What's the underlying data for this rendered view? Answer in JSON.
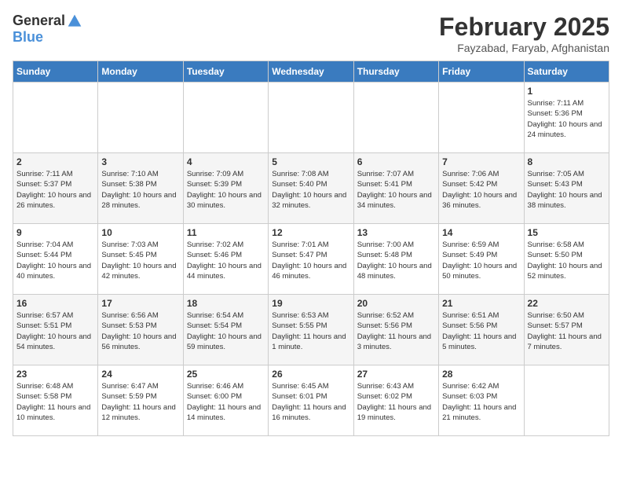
{
  "logo": {
    "general": "General",
    "blue": "Blue"
  },
  "title": "February 2025",
  "location": "Fayzabad, Faryab, Afghanistan",
  "days_of_week": [
    "Sunday",
    "Monday",
    "Tuesday",
    "Wednesday",
    "Thursday",
    "Friday",
    "Saturday"
  ],
  "weeks": [
    [
      {
        "day": "",
        "info": ""
      },
      {
        "day": "",
        "info": ""
      },
      {
        "day": "",
        "info": ""
      },
      {
        "day": "",
        "info": ""
      },
      {
        "day": "",
        "info": ""
      },
      {
        "day": "",
        "info": ""
      },
      {
        "day": "1",
        "info": "Sunrise: 7:11 AM\nSunset: 5:36 PM\nDaylight: 10 hours and 24 minutes."
      }
    ],
    [
      {
        "day": "2",
        "info": "Sunrise: 7:11 AM\nSunset: 5:37 PM\nDaylight: 10 hours and 26 minutes."
      },
      {
        "day": "3",
        "info": "Sunrise: 7:10 AM\nSunset: 5:38 PM\nDaylight: 10 hours and 28 minutes."
      },
      {
        "day": "4",
        "info": "Sunrise: 7:09 AM\nSunset: 5:39 PM\nDaylight: 10 hours and 30 minutes."
      },
      {
        "day": "5",
        "info": "Sunrise: 7:08 AM\nSunset: 5:40 PM\nDaylight: 10 hours and 32 minutes."
      },
      {
        "day": "6",
        "info": "Sunrise: 7:07 AM\nSunset: 5:41 PM\nDaylight: 10 hours and 34 minutes."
      },
      {
        "day": "7",
        "info": "Sunrise: 7:06 AM\nSunset: 5:42 PM\nDaylight: 10 hours and 36 minutes."
      },
      {
        "day": "8",
        "info": "Sunrise: 7:05 AM\nSunset: 5:43 PM\nDaylight: 10 hours and 38 minutes."
      }
    ],
    [
      {
        "day": "9",
        "info": "Sunrise: 7:04 AM\nSunset: 5:44 PM\nDaylight: 10 hours and 40 minutes."
      },
      {
        "day": "10",
        "info": "Sunrise: 7:03 AM\nSunset: 5:45 PM\nDaylight: 10 hours and 42 minutes."
      },
      {
        "day": "11",
        "info": "Sunrise: 7:02 AM\nSunset: 5:46 PM\nDaylight: 10 hours and 44 minutes."
      },
      {
        "day": "12",
        "info": "Sunrise: 7:01 AM\nSunset: 5:47 PM\nDaylight: 10 hours and 46 minutes."
      },
      {
        "day": "13",
        "info": "Sunrise: 7:00 AM\nSunset: 5:48 PM\nDaylight: 10 hours and 48 minutes."
      },
      {
        "day": "14",
        "info": "Sunrise: 6:59 AM\nSunset: 5:49 PM\nDaylight: 10 hours and 50 minutes."
      },
      {
        "day": "15",
        "info": "Sunrise: 6:58 AM\nSunset: 5:50 PM\nDaylight: 10 hours and 52 minutes."
      }
    ],
    [
      {
        "day": "16",
        "info": "Sunrise: 6:57 AM\nSunset: 5:51 PM\nDaylight: 10 hours and 54 minutes."
      },
      {
        "day": "17",
        "info": "Sunrise: 6:56 AM\nSunset: 5:53 PM\nDaylight: 10 hours and 56 minutes."
      },
      {
        "day": "18",
        "info": "Sunrise: 6:54 AM\nSunset: 5:54 PM\nDaylight: 10 hours and 59 minutes."
      },
      {
        "day": "19",
        "info": "Sunrise: 6:53 AM\nSunset: 5:55 PM\nDaylight: 11 hours and 1 minute."
      },
      {
        "day": "20",
        "info": "Sunrise: 6:52 AM\nSunset: 5:56 PM\nDaylight: 11 hours and 3 minutes."
      },
      {
        "day": "21",
        "info": "Sunrise: 6:51 AM\nSunset: 5:56 PM\nDaylight: 11 hours and 5 minutes."
      },
      {
        "day": "22",
        "info": "Sunrise: 6:50 AM\nSunset: 5:57 PM\nDaylight: 11 hours and 7 minutes."
      }
    ],
    [
      {
        "day": "23",
        "info": "Sunrise: 6:48 AM\nSunset: 5:58 PM\nDaylight: 11 hours and 10 minutes."
      },
      {
        "day": "24",
        "info": "Sunrise: 6:47 AM\nSunset: 5:59 PM\nDaylight: 11 hours and 12 minutes."
      },
      {
        "day": "25",
        "info": "Sunrise: 6:46 AM\nSunset: 6:00 PM\nDaylight: 11 hours and 14 minutes."
      },
      {
        "day": "26",
        "info": "Sunrise: 6:45 AM\nSunset: 6:01 PM\nDaylight: 11 hours and 16 minutes."
      },
      {
        "day": "27",
        "info": "Sunrise: 6:43 AM\nSunset: 6:02 PM\nDaylight: 11 hours and 19 minutes."
      },
      {
        "day": "28",
        "info": "Sunrise: 6:42 AM\nSunset: 6:03 PM\nDaylight: 11 hours and 21 minutes."
      },
      {
        "day": "",
        "info": ""
      }
    ]
  ]
}
